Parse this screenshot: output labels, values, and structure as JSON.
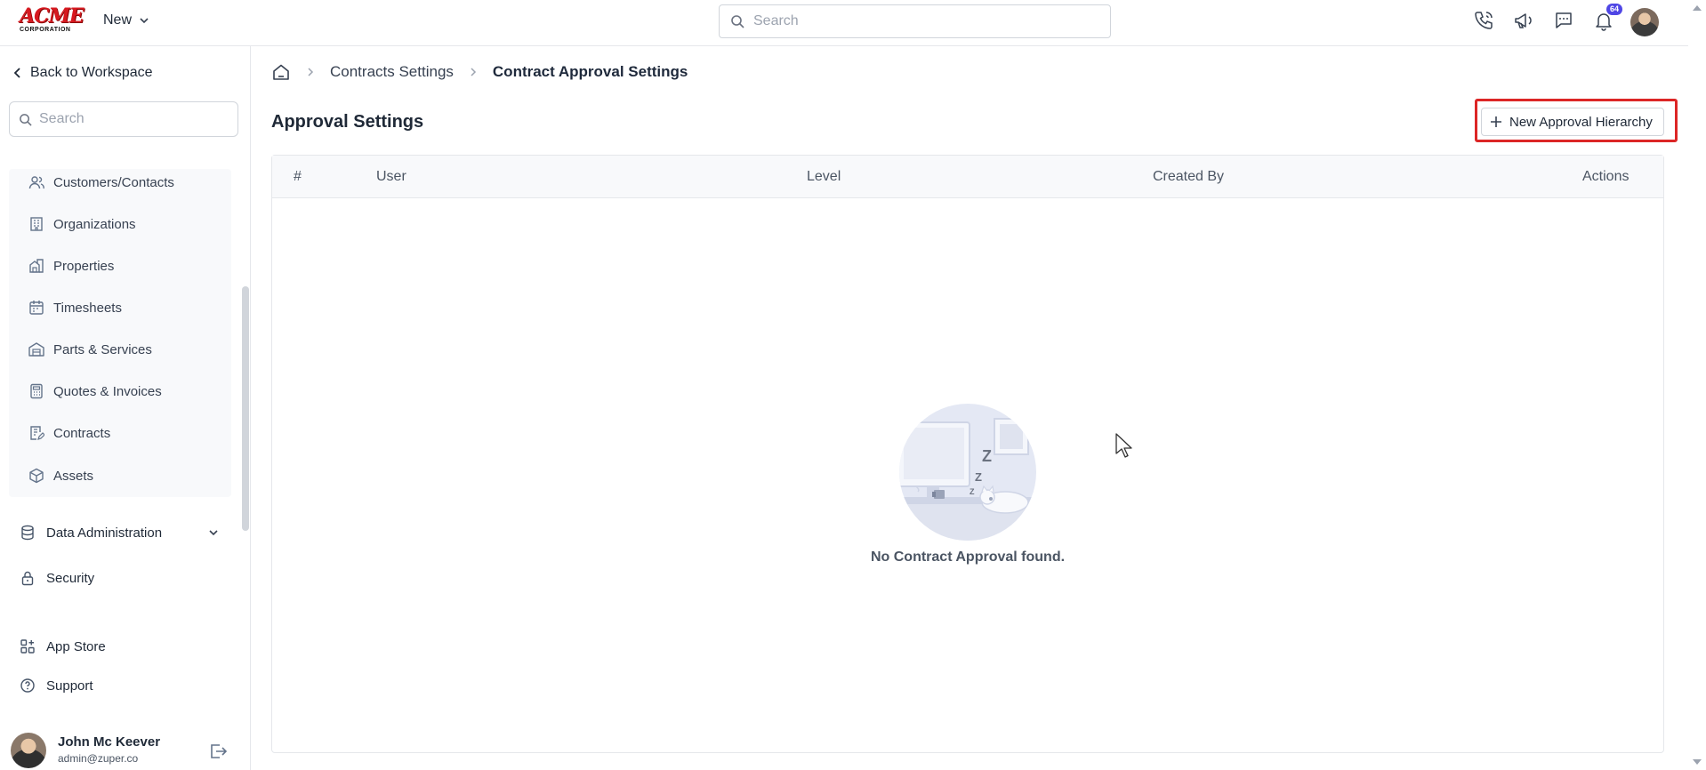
{
  "app": {
    "logo_main": "ACME",
    "logo_sub": "CORPORATION",
    "new_menu_label": "New",
    "search_placeholder": "Search",
    "notification_count": "64"
  },
  "sidebar": {
    "back_label": "Back to Workspace",
    "search_placeholder": "Search",
    "items": [
      {
        "label": "Customers/Contacts",
        "icon": "users-icon"
      },
      {
        "label": "Organizations",
        "icon": "building-icon"
      },
      {
        "label": "Properties",
        "icon": "property-icon"
      },
      {
        "label": "Timesheets",
        "icon": "calendar-icon"
      },
      {
        "label": "Parts & Services",
        "icon": "warehouse-icon"
      },
      {
        "label": "Quotes & Invoices",
        "icon": "calculator-icon"
      },
      {
        "label": "Contracts",
        "icon": "contract-icon"
      },
      {
        "label": "Assets",
        "icon": "box-icon"
      }
    ],
    "data_admin_label": "Data Administration",
    "security_label": "Security",
    "app_store_label": "App Store",
    "support_label": "Support",
    "user": {
      "name": "John Mc Keever",
      "email": "admin@zuper.co"
    }
  },
  "breadcrumb": {
    "item1": "Contracts Settings",
    "current": "Contract Approval Settings"
  },
  "main": {
    "title": "Approval Settings",
    "new_button_label": "New Approval Hierarchy",
    "table": {
      "headers": [
        "#",
        "User",
        "Level",
        "Created By",
        "Actions"
      ],
      "rows": []
    },
    "empty_text": "No Contract Approval found.",
    "empty_zzz": "Z"
  },
  "colors": {
    "accent": "#4f46e5",
    "highlight_border": "#dc2626",
    "logo_red": "#d71920"
  }
}
